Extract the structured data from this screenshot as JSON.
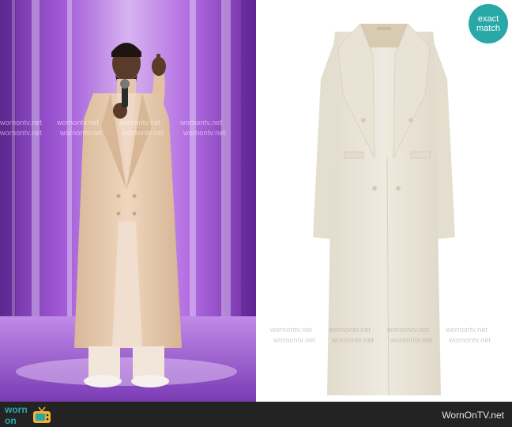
{
  "watermark": {
    "text": "wornontv.net"
  },
  "badge": {
    "line1": "exact",
    "line2": "match",
    "color": "#2aa8a8"
  },
  "footer": {
    "logo_line1": "worn",
    "logo_line2": "on",
    "logo_icon": "tv-icon",
    "credit": "WornOnTV.net",
    "background": "#232323",
    "accent": "#2aa8a8"
  },
  "colors": {
    "stage_purple": "#8a3fc4",
    "coat_cream": "#ece6da",
    "coat_beige": "#e6c9ac"
  }
}
